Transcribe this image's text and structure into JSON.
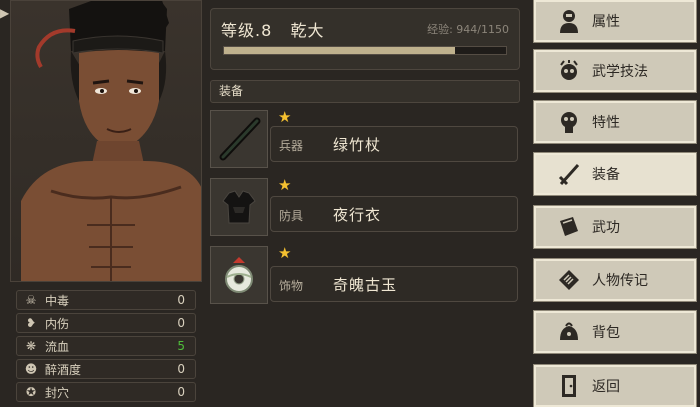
{
  "character": {
    "level_text": "等级.8",
    "name": "乾大",
    "exp_text": "经验: 944/1150",
    "exp_fraction": 0.82
  },
  "status_effects": [
    {
      "icon": "skull-icon",
      "label": "中毒",
      "value": "0",
      "color": "#d9d1be"
    },
    {
      "icon": "broken-heart-icon",
      "label": "内伤",
      "value": "0",
      "color": "#d9d1be"
    },
    {
      "icon": "blood-splatter-icon",
      "label": "流血",
      "value": "5",
      "color": "#4fbf3a"
    },
    {
      "icon": "drunk-face-icon",
      "label": "醉酒度",
      "value": "0",
      "color": "#d9d1be"
    },
    {
      "icon": "acupoint-seal-icon",
      "label": "封穴",
      "value": "0",
      "color": "#d9d1be"
    }
  ],
  "equipment": {
    "header": "装备",
    "items": [
      {
        "slot": "兵器",
        "name": "绿竹杖",
        "icon": "bamboo-staff-icon",
        "stars": 1
      },
      {
        "slot": "防具",
        "name": "夜行衣",
        "icon": "night-robe-icon",
        "stars": 1
      },
      {
        "slot": "饰物",
        "name": "奇魄古玉",
        "icon": "jade-ornament-icon",
        "stars": 1
      }
    ]
  },
  "menu": [
    {
      "label": "属性",
      "icon": "character-bust-icon",
      "active": false
    },
    {
      "label": "武学技法",
      "icon": "skull-flame-icon",
      "active": false
    },
    {
      "label": "特性",
      "icon": "skull-badge-icon",
      "active": false
    },
    {
      "label": "装备",
      "icon": "sword-icon",
      "active": true
    },
    {
      "label": "武功",
      "icon": "book-icon",
      "active": false
    },
    {
      "label": "人物传记",
      "icon": "scroll-icon",
      "active": false
    },
    {
      "label": "背包",
      "icon": "backpack-icon",
      "active": false
    },
    {
      "label": "返回",
      "icon": "door-icon",
      "active": false
    }
  ]
}
